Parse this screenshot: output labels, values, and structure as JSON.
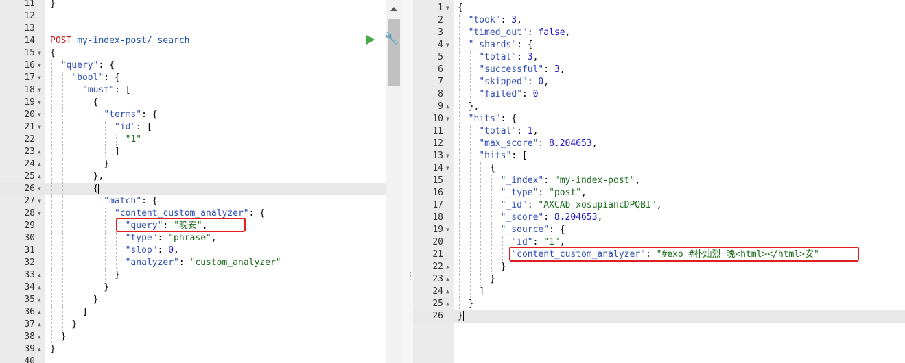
{
  "request_editor": {
    "method": "POST",
    "path": "my-index-post/_search",
    "lines": [
      {
        "num": "11",
        "indent": 0,
        "text": "}",
        "fold": ""
      },
      {
        "num": "12",
        "indent": 0,
        "text": "",
        "fold": ""
      },
      {
        "num": "13",
        "indent": 0,
        "text": "",
        "fold": ""
      },
      {
        "num": "14",
        "indent": 0,
        "text": "",
        "fold": ""
      },
      {
        "num": "15",
        "indent": 0,
        "text": "{",
        "fold": "down"
      },
      {
        "num": "16",
        "indent": 1,
        "text": "\"query\": {",
        "fold": "down"
      },
      {
        "num": "17",
        "indent": 2,
        "text": "\"bool\": {",
        "fold": "down"
      },
      {
        "num": "18",
        "indent": 3,
        "text": "\"must\": [",
        "fold": "down"
      },
      {
        "num": "19",
        "indent": 4,
        "text": "{",
        "fold": "down"
      },
      {
        "num": "20",
        "indent": 5,
        "text": "\"terms\": {",
        "fold": "down"
      },
      {
        "num": "21",
        "indent": 6,
        "text": "\"id\": [",
        "fold": "down"
      },
      {
        "num": "22",
        "indent": 7,
        "text": "\"1\"",
        "fold": ""
      },
      {
        "num": "23",
        "indent": 6,
        "text": "]",
        "fold": "up"
      },
      {
        "num": "24",
        "indent": 5,
        "text": "}",
        "fold": "up"
      },
      {
        "num": "25",
        "indent": 4,
        "text": "},",
        "fold": "up"
      },
      {
        "num": "26",
        "indent": 4,
        "text": "{",
        "fold": "down"
      },
      {
        "num": "27",
        "indent": 5,
        "text": "\"match\": {",
        "fold": "down"
      },
      {
        "num": "28",
        "indent": 6,
        "text": "\"content_custom_analyzer\": {",
        "fold": "down"
      },
      {
        "num": "29",
        "indent": 7,
        "text": "\"query\": \"晚安\",",
        "fold": ""
      },
      {
        "num": "30",
        "indent": 7,
        "text": "\"type\": \"phrase\",",
        "fold": ""
      },
      {
        "num": "31",
        "indent": 7,
        "text": "\"slop\": 0,",
        "fold": ""
      },
      {
        "num": "32",
        "indent": 7,
        "text": "\"analyzer\": \"custom_analyzer\"",
        "fold": ""
      },
      {
        "num": "33",
        "indent": 6,
        "text": "}",
        "fold": "up"
      },
      {
        "num": "34",
        "indent": 5,
        "text": "}",
        "fold": "up"
      },
      {
        "num": "35",
        "indent": 4,
        "text": "}",
        "fold": "up"
      },
      {
        "num": "36",
        "indent": 3,
        "text": "]",
        "fold": "up"
      },
      {
        "num": "37",
        "indent": 2,
        "text": "}",
        "fold": "up"
      },
      {
        "num": "38",
        "indent": 1,
        "text": "}",
        "fold": "up"
      },
      {
        "num": "39",
        "indent": 0,
        "text": "}",
        "fold": "up"
      },
      {
        "num": "40",
        "indent": 0,
        "text": "",
        "fold": ""
      }
    ]
  },
  "response_viewer": {
    "lines": [
      {
        "num": "1",
        "indent": 0,
        "text": "{",
        "fold": "down"
      },
      {
        "num": "2",
        "indent": 1,
        "text": "\"took\": 3,",
        "fold": ""
      },
      {
        "num": "3",
        "indent": 1,
        "text": "\"timed_out\": false,",
        "fold": ""
      },
      {
        "num": "4",
        "indent": 1,
        "text": "\"_shards\": {",
        "fold": "down"
      },
      {
        "num": "5",
        "indent": 2,
        "text": "\"total\": 3,",
        "fold": ""
      },
      {
        "num": "6",
        "indent": 2,
        "text": "\"successful\": 3,",
        "fold": ""
      },
      {
        "num": "7",
        "indent": 2,
        "text": "\"skipped\": 0,",
        "fold": ""
      },
      {
        "num": "8",
        "indent": 2,
        "text": "\"failed\": 0",
        "fold": ""
      },
      {
        "num": "9",
        "indent": 1,
        "text": "},",
        "fold": "up"
      },
      {
        "num": "10",
        "indent": 1,
        "text": "\"hits\": {",
        "fold": "down"
      },
      {
        "num": "11",
        "indent": 2,
        "text": "\"total\": 1,",
        "fold": ""
      },
      {
        "num": "12",
        "indent": 2,
        "text": "\"max_score\": 8.204653,",
        "fold": ""
      },
      {
        "num": "13",
        "indent": 2,
        "text": "\"hits\": [",
        "fold": "down"
      },
      {
        "num": "14",
        "indent": 3,
        "text": "{",
        "fold": "down"
      },
      {
        "num": "15",
        "indent": 4,
        "text": "\"_index\": \"my-index-post\",",
        "fold": ""
      },
      {
        "num": "16",
        "indent": 4,
        "text": "\"_type\": \"post\",",
        "fold": ""
      },
      {
        "num": "17",
        "indent": 4,
        "text": "\"_id\": \"AXCAb-xosupiancDPQBI\",",
        "fold": ""
      },
      {
        "num": "18",
        "indent": 4,
        "text": "\"_score\": 8.204653,",
        "fold": ""
      },
      {
        "num": "19",
        "indent": 4,
        "text": "\"_source\": {",
        "fold": "down"
      },
      {
        "num": "20",
        "indent": 5,
        "text": "\"id\": \"1\",",
        "fold": ""
      },
      {
        "num": "21",
        "indent": 5,
        "text": "\"content_custom_analyzer\": \"#exo #朴灿烈 晚<html></html>安\"",
        "fold": ""
      },
      {
        "num": "22",
        "indent": 4,
        "text": "}",
        "fold": "up"
      },
      {
        "num": "23",
        "indent": 3,
        "text": "}",
        "fold": "up"
      },
      {
        "num": "24",
        "indent": 2,
        "text": "]",
        "fold": "up"
      },
      {
        "num": "25",
        "indent": 1,
        "text": "}",
        "fold": "up"
      },
      {
        "num": "26",
        "indent": 0,
        "text": "}",
        "fold": ""
      }
    ]
  },
  "colors": {
    "key": "#2f4fb4",
    "string": "#1a6b1a",
    "number": "#1d17c4",
    "method": "#c41a16",
    "url": "#1c4fa8",
    "highlight_box": "#e02020",
    "gutter_bg": "#ebebeb",
    "active_line_bg": "#e8e8e8"
  },
  "icons": {
    "run": "play-triangle-icon",
    "settings": "wrench-icon",
    "splitter": "vertical-dots-icon"
  }
}
